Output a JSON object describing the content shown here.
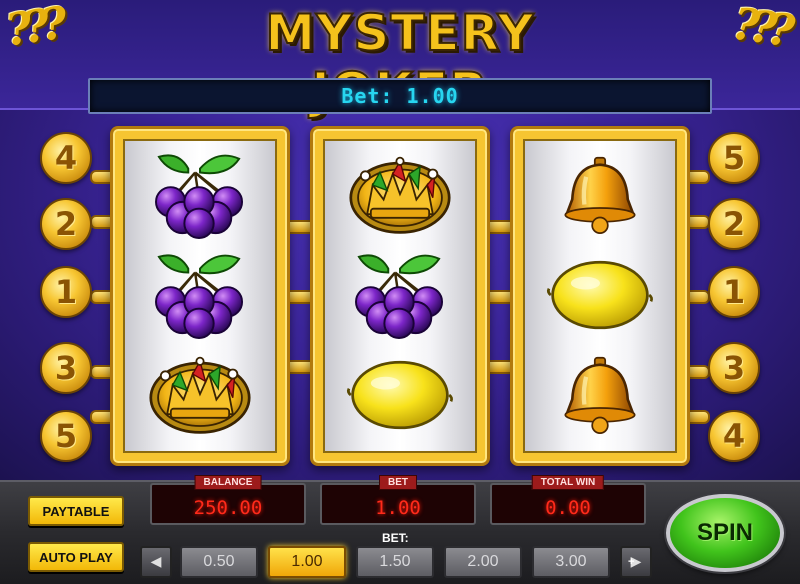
{
  "game": {
    "title": "MYSTERY JOKER",
    "corner_decor": "???"
  },
  "bet_display": "Bet: 1.00",
  "paylines": {
    "left": [
      "4",
      "2",
      "1",
      "3",
      "5"
    ],
    "right": [
      "5",
      "2",
      "1",
      "3",
      "4"
    ]
  },
  "reels": [
    {
      "symbols": [
        "plums-icon",
        "plums-icon",
        "joker-crown-icon"
      ]
    },
    {
      "symbols": [
        "joker-crown-icon",
        "plums-icon",
        "lemon-icon"
      ]
    },
    {
      "symbols": [
        "bell-icon",
        "lemon-icon",
        "bell-icon"
      ]
    }
  ],
  "readouts": {
    "balance": {
      "label": "BALANCE",
      "value": "250.00"
    },
    "bet": {
      "label": "BET",
      "value": "1.00"
    },
    "total_win": {
      "label": "TOTAL WIN",
      "value": "0.00"
    }
  },
  "buttons": {
    "paytable": "PAYTABLE",
    "autoplay": "AUTO PLAY",
    "spin": "SPIN",
    "decrease": "◀",
    "increase": "▶",
    "decrease_sign": "-",
    "increase_sign": "+"
  },
  "bet_selector": {
    "label": "BET:",
    "options": [
      "0.50",
      "1.00",
      "1.50",
      "2.00",
      "3.00"
    ],
    "selected": "1.00"
  },
  "colors": {
    "gold": "#f5c21c",
    "bet_text": "#27d6f0",
    "readout_text": "#ff2a1a",
    "spin_green": "#41c41c",
    "background_purple": "#3a2497"
  }
}
